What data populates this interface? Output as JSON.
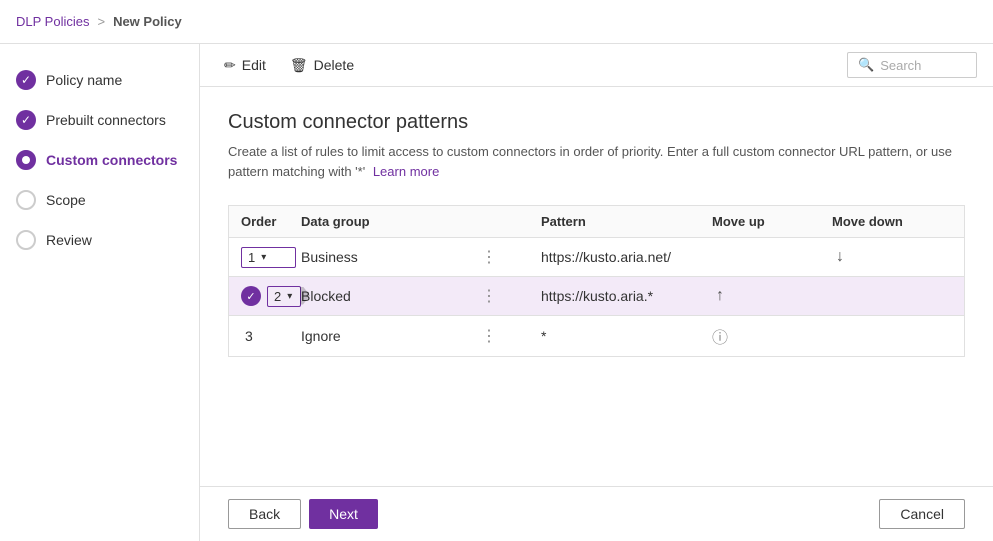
{
  "breadcrumb": {
    "parent": "DLP Policies",
    "separator": ">",
    "current": "New Policy"
  },
  "toolbar": {
    "edit_label": "Edit",
    "delete_label": "Delete",
    "search_placeholder": "Search"
  },
  "sidebar": {
    "items": [
      {
        "id": "policy-name",
        "label": "Policy name",
        "state": "done"
      },
      {
        "id": "prebuilt-connectors",
        "label": "Prebuilt connectors",
        "state": "done"
      },
      {
        "id": "custom-connectors",
        "label": "Custom connectors",
        "state": "active"
      },
      {
        "id": "scope",
        "label": "Scope",
        "state": "empty"
      },
      {
        "id": "review",
        "label": "Review",
        "state": "empty"
      }
    ]
  },
  "page": {
    "title": "Custom connector patterns",
    "description": "Create a list of rules to limit access to custom connectors in order of priority. Enter a full custom connector URL pattern, or use pattern matching with '*'",
    "learn_more": "Learn more"
  },
  "table": {
    "headers": [
      "Order",
      "Data group",
      "",
      "Pattern",
      "Move up",
      "Move down"
    ],
    "rows": [
      {
        "order": "1",
        "order_type": "select",
        "data_group": "Business",
        "has_ellipsis": true,
        "pattern": "https://kusto.aria.net/",
        "move_up": false,
        "move_down": true,
        "highlighted": false,
        "checked": false
      },
      {
        "order": "2",
        "order_type": "select",
        "data_group": "Blocked",
        "has_ellipsis": true,
        "pattern": "https://kusto.aria.*",
        "move_up": true,
        "move_down": false,
        "highlighted": true,
        "checked": true
      },
      {
        "order": "3",
        "order_type": "text",
        "data_group": "Ignore",
        "has_ellipsis": true,
        "pattern": "*",
        "move_up": false,
        "move_down": false,
        "highlighted": false,
        "checked": false,
        "has_info": true
      }
    ]
  },
  "footer": {
    "back_label": "Back",
    "next_label": "Next",
    "cancel_label": "Cancel"
  },
  "icons": {
    "edit": "✏",
    "delete": "🗑",
    "search": "🔍",
    "check": "✓",
    "arrow_up": "↑",
    "arrow_down": "↓",
    "ellipsis": "⋮",
    "info": "ⓘ",
    "chevron_down": "⌄"
  }
}
